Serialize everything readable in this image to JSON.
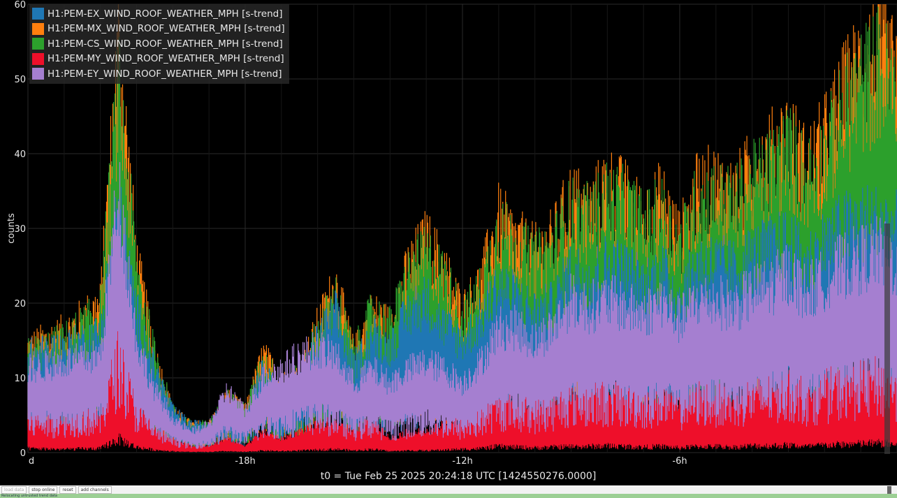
{
  "chart_data": {
    "type": "line",
    "title": "",
    "xlabel": "t0 = Tue Feb 25 2025 20:24:18 UTC [1424550276.0000]",
    "ylabel": "counts",
    "ylim": [
      0,
      60
    ],
    "xlim": [
      -24,
      0
    ],
    "x_unit": "hours relative to t0",
    "x_ticks": [
      -24,
      -18,
      -12,
      -6
    ],
    "x_tick_labels": [
      "d",
      "-18h",
      "-12h",
      "-6h"
    ],
    "y_ticks": [
      0,
      10,
      20,
      30,
      40,
      50,
      60
    ],
    "y_tick_labels": [
      "0",
      "10",
      "20",
      "30",
      "40",
      "50",
      "60"
    ],
    "grid": true,
    "legend_position": "top-left",
    "x": [
      -24,
      -23,
      -22,
      -21.5,
      -21,
      -20.5,
      -20,
      -19.5,
      -19,
      -18.5,
      -18,
      -17.5,
      -17,
      -16.5,
      -16,
      -15.5,
      -15,
      -14.5,
      -14,
      -13.5,
      -13,
      -12.5,
      -12,
      -11.5,
      -11,
      -10.5,
      -10,
      -9.5,
      -9,
      -8.5,
      -8,
      -7.5,
      -7,
      -6.5,
      -6,
      -5.5,
      -5,
      -4.5,
      -4,
      -3.5,
      -3,
      -2.5,
      -2,
      -1.5,
      -1,
      -0.5,
      0
    ],
    "series": [
      {
        "name": "H1:PEM-EX_WIND_ROOF_WEATHER_MPH [s-trend]",
        "color": "#1f77b4",
        "values": [
          14,
          15,
          17,
          35,
          20,
          12,
          6,
          4,
          4,
          7,
          5,
          12,
          8,
          10,
          16,
          20,
          12,
          17,
          15,
          20,
          22,
          18,
          16,
          19,
          24,
          22,
          20,
          21,
          26,
          25,
          27,
          26,
          24,
          26,
          22,
          27,
          27,
          26,
          28,
          29,
          30,
          27,
          30,
          32,
          33,
          33,
          32
        ]
      },
      {
        "name": "H1:PEM-MX_WIND_ROOF_WEATHER_MPH [s-trend]",
        "color": "#ff7f0e",
        "values": [
          15,
          17,
          21,
          58,
          27,
          14,
          6,
          4,
          4,
          8,
          6,
          14,
          10,
          11,
          18,
          24,
          14,
          20,
          18,
          26,
          30,
          26,
          20,
          24,
          33,
          30,
          28,
          30,
          36,
          34,
          38,
          36,
          33,
          36,
          30,
          37,
          38,
          36,
          40,
          42,
          45,
          40,
          44,
          50,
          55,
          58,
          52
        ]
      },
      {
        "name": "H1:PEM-CS_WIND_ROOF_WEATHER_MPH [s-trend]",
        "color": "#2ca02c",
        "values": [
          14,
          16,
          20,
          52,
          26,
          14,
          6,
          4,
          4,
          8,
          6,
          13,
          10,
          11,
          17,
          22,
          14,
          20,
          18,
          25,
          28,
          25,
          19,
          23,
          32,
          29,
          27,
          29,
          34,
          33,
          36,
          35,
          32,
          34,
          29,
          36,
          36,
          35,
          38,
          40,
          43,
          39,
          42,
          48,
          52,
          55,
          50
        ]
      },
      {
        "name": "H1:PEM-MY_WIND_ROOF_WEATHER_MPH [s-trend]",
        "color": "#ee0f2a",
        "values": [
          6,
          5,
          6,
          20,
          8,
          4,
          2,
          1,
          1,
          2,
          1,
          3,
          2,
          3,
          4,
          5,
          3,
          5,
          2,
          3,
          3,
          4,
          5,
          6,
          9,
          8,
          7,
          8,
          9,
          9,
          10,
          9,
          8,
          9,
          7,
          9,
          9,
          8,
          10,
          10,
          11,
          9,
          11,
          12,
          13,
          14,
          12
        ]
      },
      {
        "name": "H1:PEM-EY_WIND_ROOF_WEATHER_MPH [s-trend]",
        "color": "#a57fd0",
        "values": [
          12,
          13,
          14,
          38,
          16,
          9,
          5,
          3,
          4,
          9,
          6,
          11,
          12,
          14,
          15,
          14,
          10,
          12,
          10,
          12,
          13,
          12,
          10,
          13,
          18,
          18,
          16,
          18,
          22,
          21,
          22,
          21,
          20,
          22,
          19,
          22,
          22,
          21,
          23,
          24,
          26,
          23,
          25,
          27,
          28,
          29,
          27
        ]
      }
    ]
  },
  "toolbar": {
    "buttons": [
      "load data",
      "stop online",
      "reset",
      "add channels"
    ]
  },
  "status": {
    "text": "Relocating untrusted trend data"
  }
}
